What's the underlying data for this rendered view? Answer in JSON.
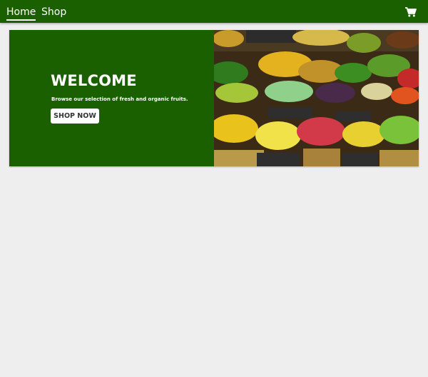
{
  "nav": {
    "home_label": "Home",
    "shop_label": "Shop",
    "cart_icon": "shopping-cart-icon"
  },
  "hero": {
    "title": "WELCOME",
    "subtitle": "Browse our selection of fresh and organic fruits.",
    "cta_label": "SHOP NOW",
    "image": "fruit-market-photo"
  },
  "colors": {
    "brand_green": "#1b6000",
    "page_background": "#eeeeee",
    "text_on_brand": "#ffffff"
  }
}
